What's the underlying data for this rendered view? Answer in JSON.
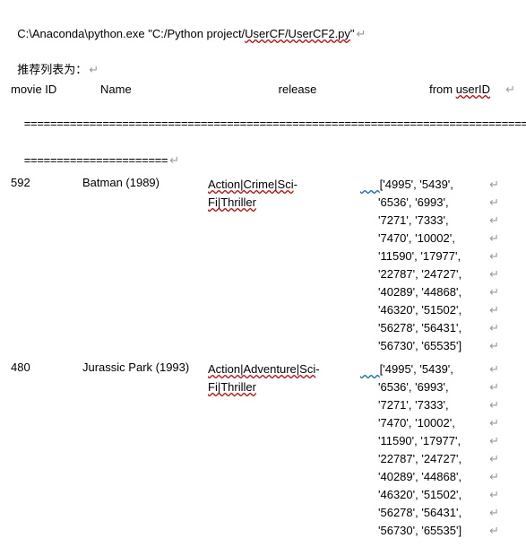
{
  "cmd": {
    "exe_path_pre": "C:\\Anaconda\\python.exe \"C:/Python project/",
    "path_underlined": "UserCF/UserCF2.py",
    "quote_end": "\""
  },
  "title_label": "推荐列表为：",
  "header": {
    "movie_id": "movie ID",
    "name": "Name",
    "release": "release",
    "from_user": "from ",
    "from_user_red": "userID"
  },
  "divider_top": "====================================================================================",
  "divider_sub": "======================",
  "eol": "↵",
  "rows": [
    {
      "id": "592",
      "name": "Batman (1989)",
      "release_parts": [
        "Action|Crime|Sci",
        "-",
        "Fi|Thriller"
      ],
      "from_first": "['4995', '5439',",
      "from_rest": [
        "'6536', '6993',",
        "'7271', '7333',",
        "'7470', '10002',",
        "'11590', '17977',",
        "'22787', '24727',",
        "'40289', '44868',",
        "'46320', '51502',",
        "'56278', '56431',",
        "'56730', '65535']"
      ]
    },
    {
      "id": "480",
      "name": "Jurassic Park (1993)",
      "release_parts": [
        "Action|Adventure|Sci",
        "-",
        "Fi|Thriller"
      ],
      "from_first": "['4995', '5439',",
      "from_rest": [
        "'6536', '6993',",
        "'7271', '7333',",
        "'7470', '10002',",
        "'11590', '17977',",
        "'22787', '24727',",
        "'40289', '44868',",
        "'46320', '51502',",
        "'56278', '56431',",
        "'56730', '65535']"
      ]
    }
  ]
}
